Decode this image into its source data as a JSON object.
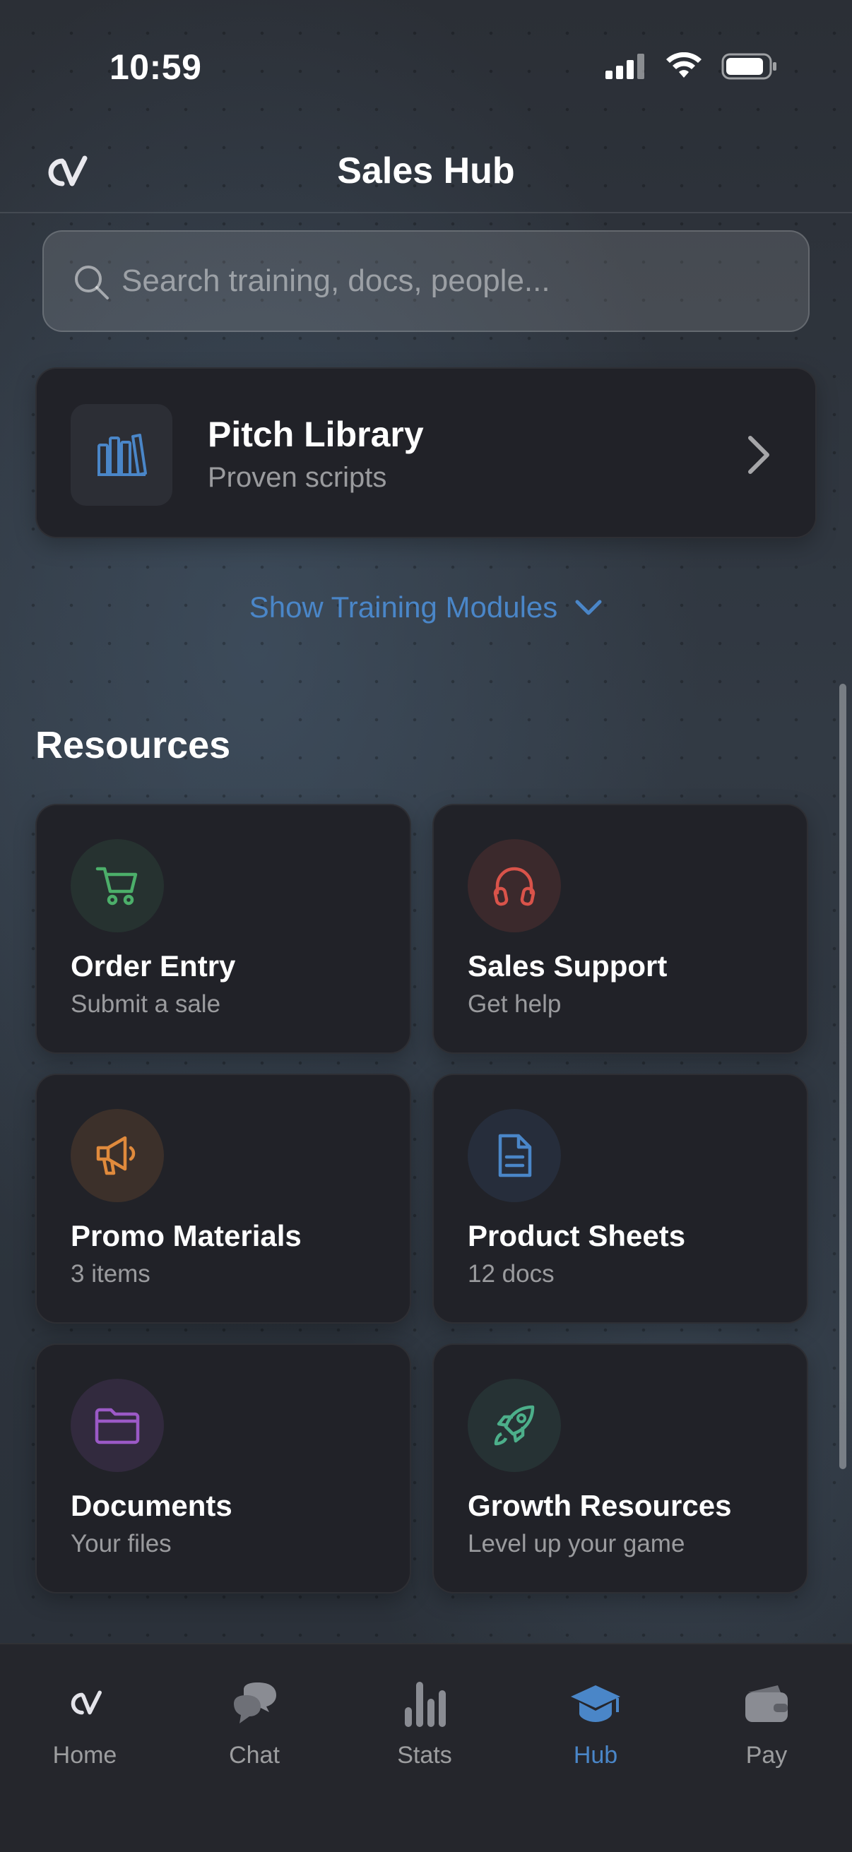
{
  "status_bar": {
    "time": "10:59",
    "icons": [
      "cellular-signal-icon",
      "wifi-icon",
      "battery-icon"
    ]
  },
  "header": {
    "logo": "CV",
    "title": "Sales Hub"
  },
  "search": {
    "placeholder": "Search training, docs, people...",
    "icon": "search-icon"
  },
  "pitch_card": {
    "title": "Pitch Library",
    "subtitle": "Proven scripts",
    "icon": "books-icon"
  },
  "training_toggle": {
    "label": "Show Training Modules",
    "icon": "chevron-down-icon"
  },
  "resources": {
    "title": "Resources",
    "tiles": [
      {
        "title": "Order Entry",
        "subtitle": "Submit a sale",
        "icon": "shopping-cart-icon",
        "color": "#4caf6a"
      },
      {
        "title": "Sales Support",
        "subtitle": "Get help",
        "icon": "headphones-icon",
        "color": "#d9534a"
      },
      {
        "title": "Promo Materials",
        "subtitle": "3 items",
        "icon": "megaphone-icon",
        "color": "#e08a3c"
      },
      {
        "title": "Product Sheets",
        "subtitle": "12 docs",
        "icon": "document-icon",
        "color": "#4a86c8"
      },
      {
        "title": "Documents",
        "subtitle": "Your files",
        "icon": "folder-icon",
        "color": "#9b59c6"
      },
      {
        "title": "Growth Resources",
        "subtitle": "Level up your game",
        "icon": "rocket-icon",
        "color": "#4caf8a"
      }
    ]
  },
  "tabbar": {
    "tabs": [
      {
        "label": "Home",
        "icon": "cv-logo-icon",
        "active": false
      },
      {
        "label": "Chat",
        "icon": "chat-bubbles-icon",
        "active": false
      },
      {
        "label": "Stats",
        "icon": "bar-chart-icon",
        "active": false
      },
      {
        "label": "Hub",
        "icon": "graduation-cap-icon",
        "active": true
      },
      {
        "label": "Pay",
        "icon": "wallet-icon",
        "active": false
      }
    ]
  },
  "colors": {
    "accent": "#4a86c8",
    "card_bg": "#212228",
    "tabbar_bg": "#25262c"
  }
}
